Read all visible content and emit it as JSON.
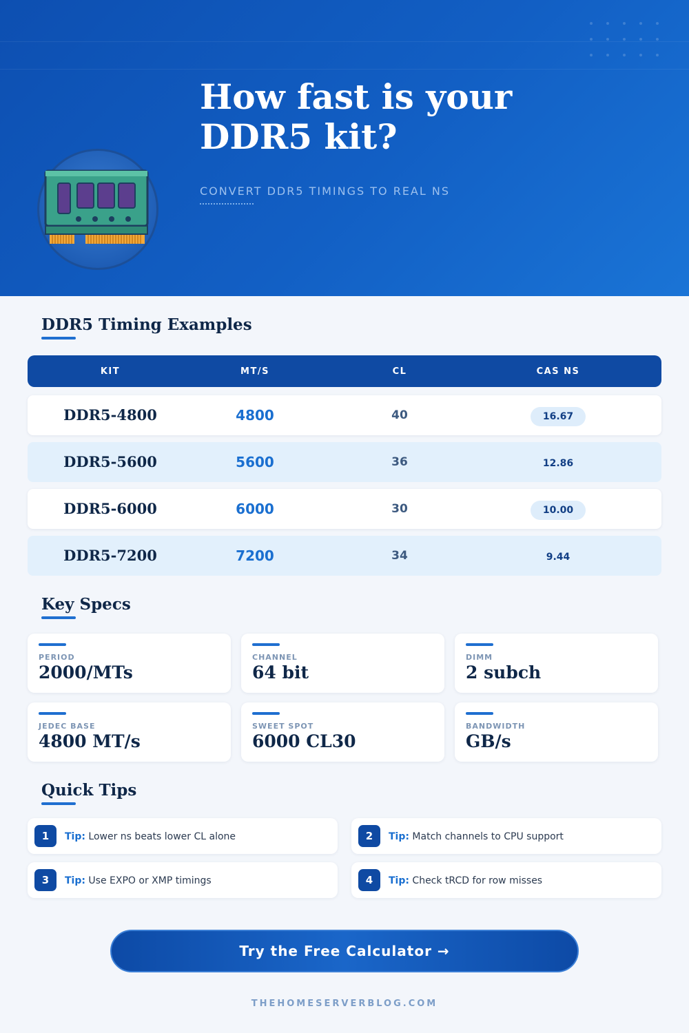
{
  "hero": {
    "title": "How fast is your DDR5 kit?",
    "subtitle": "CONVERT DDR5 TIMINGS TO REAL NS",
    "icon": "ram-module-icon"
  },
  "timing": {
    "title": "DDR5 Timing Examples",
    "headers": [
      "KIT",
      "MT/S",
      "CL",
      "CAS NS"
    ],
    "rows": [
      {
        "kit": "DDR5-4800",
        "mts": "4800",
        "cl": "40",
        "ns": "16.67"
      },
      {
        "kit": "DDR5-5600",
        "mts": "5600",
        "cl": "36",
        "ns": "12.86"
      },
      {
        "kit": "DDR5-6000",
        "mts": "6000",
        "cl": "30",
        "ns": "10.00"
      },
      {
        "kit": "DDR5-7200",
        "mts": "7200",
        "cl": "34",
        "ns": "9.44"
      }
    ]
  },
  "specs": {
    "title": "Key Specs",
    "items": [
      {
        "label": "PERIOD",
        "value": "2000/MTs"
      },
      {
        "label": "CHANNEL",
        "value": "64 bit"
      },
      {
        "label": "DIMM",
        "value": "2 subch"
      },
      {
        "label": "JEDEC BASE",
        "value": "4800 MT/s"
      },
      {
        "label": "SWEET SPOT",
        "value": "6000 CL30"
      },
      {
        "label": "BANDWIDTH",
        "value": "GB/s"
      }
    ]
  },
  "tips": {
    "title": "Quick Tips",
    "prefix": "Tip:",
    "items": [
      {
        "num": "1",
        "text": "Lower ns beats lower CL alone"
      },
      {
        "num": "2",
        "text": "Match channels to CPU support"
      },
      {
        "num": "3",
        "text": "Use EXPO or XMP timings"
      },
      {
        "num": "4",
        "text": "Check tRCD for row misses"
      }
    ]
  },
  "cta": {
    "label": "Try the Free Calculator →"
  },
  "footer": {
    "site": "THEHOMESERVERBLOG.COM"
  },
  "colors": {
    "primary": "#0f4aa3",
    "accent": "#1a6fd0",
    "ink": "#0f2748",
    "background": "#f3f6fb"
  }
}
